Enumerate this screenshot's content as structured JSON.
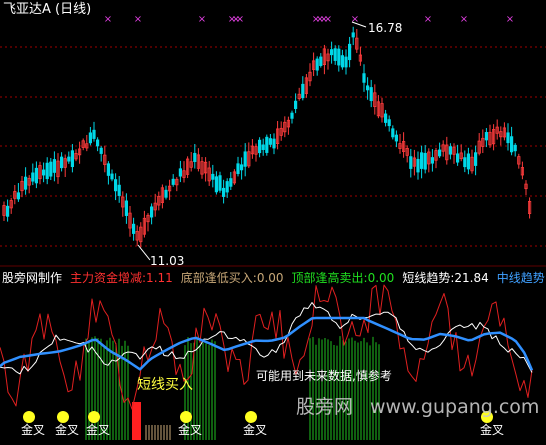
{
  "colors": {
    "background": "#000000",
    "up_candle": "#ff3c3c",
    "down_candle": "#00d8e8",
    "grid": "#a00000",
    "marker": "#e040e0",
    "label_white": "#ffffff",
    "label_red": "#ff3030",
    "label_tan": "#c8a878",
    "label_green": "#20e020",
    "label_blue": "#40a0ff",
    "label_yellow": "#ffff40",
    "watermark": "#c8c8c8"
  },
  "chart_title": "飞亚达A (日线)",
  "price_high_label": "16.78",
  "price_low_label": "11.03",
  "indicator_bar": {
    "source": "股旁网制作",
    "main_funds": "主力资金增减:1.11",
    "bottom_buy": "底部逢低买入:0.00",
    "top_sell": "顶部逢高卖出:0.00",
    "short_trend": "短线趋势:21.84",
    "mid_trend": "中线趋势:5"
  },
  "annotations": {
    "short_buy": "短线买入",
    "future_data": "可能用到未来数据,慎参考"
  },
  "golden_cross_labels": [
    "金叉",
    "金叉",
    "金叉",
    "金叉",
    "金叉",
    "金叉"
  ],
  "watermark": {
    "cn": "股旁网",
    "url": "www.gupang.com"
  }
}
